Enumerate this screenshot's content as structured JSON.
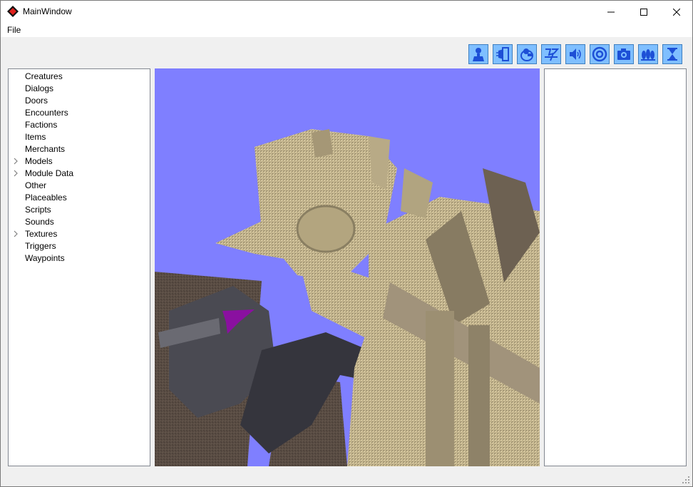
{
  "window": {
    "title": "MainWindow"
  },
  "menu": {
    "file_label": "File"
  },
  "toolbar": {
    "buttons": [
      {
        "name": "creature-icon"
      },
      {
        "name": "door-icon"
      },
      {
        "name": "encounter-icon"
      },
      {
        "name": "trigger-icon"
      },
      {
        "name": "sound-icon"
      },
      {
        "name": "waypoint-icon"
      },
      {
        "name": "camera-icon"
      },
      {
        "name": "placeable-icon"
      },
      {
        "name": "hourglass-icon"
      }
    ]
  },
  "tree": {
    "items": [
      {
        "label": "Creatures",
        "expandable": false
      },
      {
        "label": "Dialogs",
        "expandable": false
      },
      {
        "label": "Doors",
        "expandable": false
      },
      {
        "label": "Encounters",
        "expandable": false
      },
      {
        "label": "Factions",
        "expandable": false
      },
      {
        "label": "Items",
        "expandable": false
      },
      {
        "label": "Merchants",
        "expandable": false
      },
      {
        "label": "Models",
        "expandable": true
      },
      {
        "label": "Module Data",
        "expandable": true
      },
      {
        "label": "Other",
        "expandable": false
      },
      {
        "label": "Placeables",
        "expandable": false
      },
      {
        "label": "Scripts",
        "expandable": false
      },
      {
        "label": "Sounds",
        "expandable": false
      },
      {
        "label": "Textures",
        "expandable": true
      },
      {
        "label": "Triggers",
        "expandable": false
      },
      {
        "label": "Waypoints",
        "expandable": false
      }
    ]
  },
  "colors": {
    "sky": "#7f7fff",
    "toolbar_button": "#7fbfff",
    "toolbar_icon": "#0000ff",
    "app_icon": "#e0201c"
  }
}
